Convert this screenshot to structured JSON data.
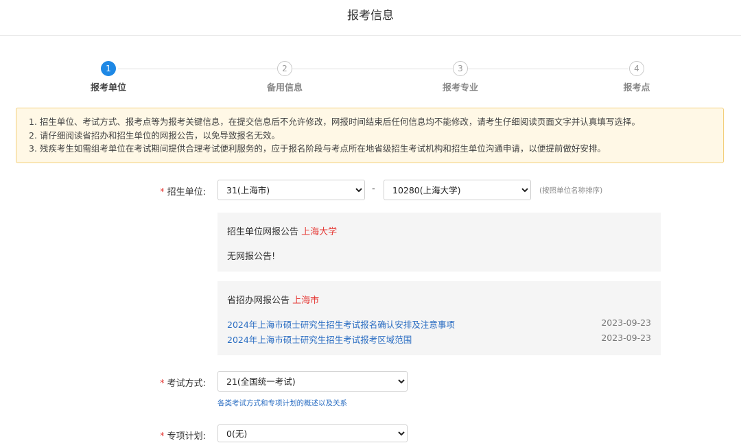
{
  "header": {
    "title": "报考信息"
  },
  "steps": [
    {
      "num": "1",
      "label": "报考单位",
      "active": true
    },
    {
      "num": "2",
      "label": "备用信息",
      "active": false
    },
    {
      "num": "3",
      "label": "报考专业",
      "active": false
    },
    {
      "num": "4",
      "label": "报考点",
      "active": false
    }
  ],
  "notice": [
    "1. 招生单位、考试方式、报考点等为报考关键信息，在提交信息后不允许修改，网报时间结束后任何信息均不能修改，请考生仔细阅读页面文字并认真填写选择。",
    "2. 请仔细阅读省招办和招生单位的网报公告，以免导致报名无效。",
    "3. 残疾考生如需组考单位在考试期间提供合理考试便利服务的，应于报名阶段与考点所在地省级招生考试机构和招生单位沟通申请，以便提前做好安排。"
  ],
  "form": {
    "required_mark": "*",
    "unit_label": "招生单位:",
    "province_value": "31(上海市)",
    "dash": "-",
    "school_value": "10280(上海大学)",
    "sort_hint": "(按照单位名称排序)",
    "exam_label": "考试方式:",
    "exam_value": "21(全国统一考试)",
    "exam_link": "各类考试方式和专项计划的概述以及关系",
    "plan_label": "专项计划:",
    "plan_value": "0(无)"
  },
  "school_notice": {
    "title": "招生单位网报公告",
    "school": "上海大学",
    "body": "无网报公告!"
  },
  "province_notice": {
    "title": "省招办网报公告",
    "province": "上海市",
    "items": [
      {
        "text": "2024年上海市硕士研究生招生考试报名确认安排及注意事项",
        "date": "2023-09-23"
      },
      {
        "text": "2024年上海市硕士研究生招生考试报考区域范围",
        "date": "2023-09-23"
      }
    ]
  },
  "colors": {
    "accent": "#1e88e5",
    "required": "#e53935",
    "link": "#2a6dc2",
    "notice_bg": "#fff8e6",
    "notice_border": "#f3cf7a"
  }
}
